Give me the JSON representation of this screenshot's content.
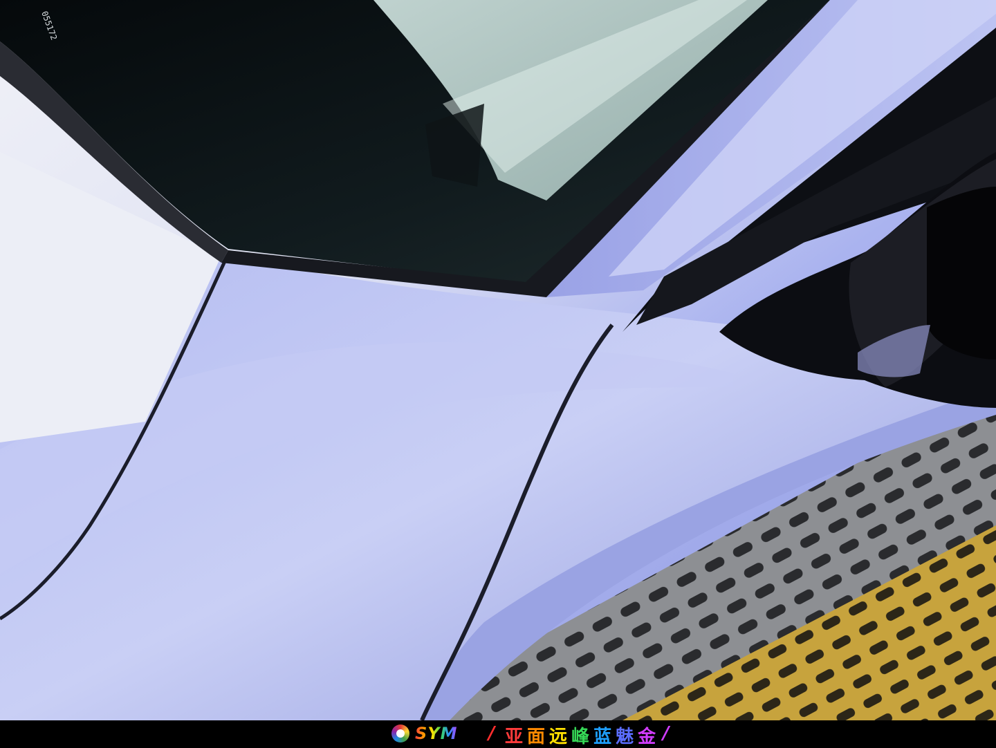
{
  "photo": {
    "subject": "car body close-up",
    "paint_colors": {
      "panel_light": "#e9ebf6",
      "panel_periwinkle": "#a9b2ef",
      "panel_shadow": "#7d86cf",
      "glass_dark": "#0c1416",
      "trim_black": "#1a1c22",
      "floor_grate": "#8a8c90",
      "floor_yellow": "#c9a63a"
    },
    "glass_text": "055172"
  },
  "caption": {
    "logo_text": "SYM",
    "slash_left": "/",
    "title_chars": [
      "亚",
      "面",
      "远",
      "峰",
      "蓝",
      "魅",
      "金"
    ],
    "slash_right": "/",
    "title_colors": [
      "#ff3b3b",
      "#ff8a00",
      "#ffe000",
      "#36d957",
      "#1ea0ff",
      "#5b6dff",
      "#d23cff"
    ]
  }
}
